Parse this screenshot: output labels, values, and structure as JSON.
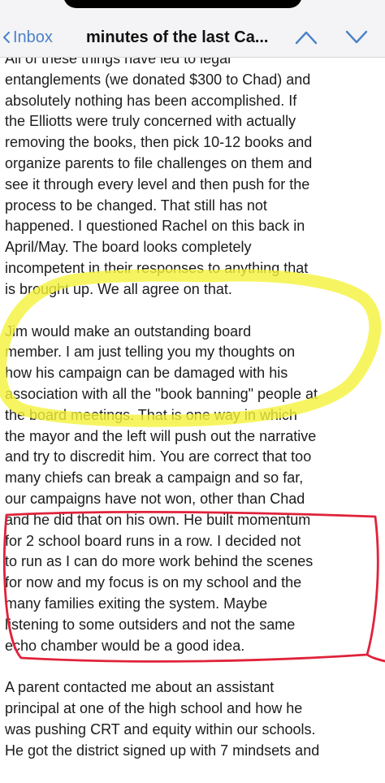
{
  "nav": {
    "back_label": "Inbox",
    "title": "minutes of the last Ca...",
    "icons": {
      "back": "chevron-left-icon",
      "prev": "chevron-up-icon",
      "next": "chevron-down-icon"
    },
    "accent_color": "#4a82c9"
  },
  "email": {
    "paragraphs": [
      {
        "lines": [
          "All of these things have led to legal",
          "entanglements (we donated $300 to Chad) and",
          "absolutely nothing has been accomplished.  If",
          "the Elliotts were truly concerned with actually",
          "removing the books, then pick 10-12 books and",
          "organize parents to file challenges on them and",
          "see it through every level and then push for the",
          "process to be changed.  That still has not",
          "happened.  I questioned Rachel on this back in",
          "April/May.  The board looks completely",
          "incompetent in their responses to anything that",
          "is brought up.  We all agree on that."
        ]
      },
      {
        "lines": [
          " Jim would make an outstanding board",
          "member.  I am just telling you my thoughts on",
          "how his campaign can be damaged with his",
          "association with all the \"book banning\" people at",
          "the board meetings.  That is one way in which",
          "the mayor and the left will push out the narrative",
          "and try to discredit him.   You are correct that too",
          "many chiefs can break a campaign and so far,",
          "our campaigns have not won, other than Chad",
          "and he did that on his own.  He built momentum",
          "for 2 school board runs in a row.  I decided not",
          "to run as I can do more work behind the scenes",
          "for now and my focus is on my school and the",
          "many families exiting the system.  Maybe",
          "listening to some outsiders and not the same",
          "echo chamber would be a good idea."
        ]
      },
      {
        "lines": [
          "A parent contacted me about an assistant",
          "principal at one of the high school and how he",
          "was pushing CRT and equity within our schools.",
          "He got the district signed up with 7 mindsets and"
        ]
      }
    ]
  },
  "annotations": {
    "yellow_color": "#f4f23a",
    "red_color": "#e0223a"
  }
}
